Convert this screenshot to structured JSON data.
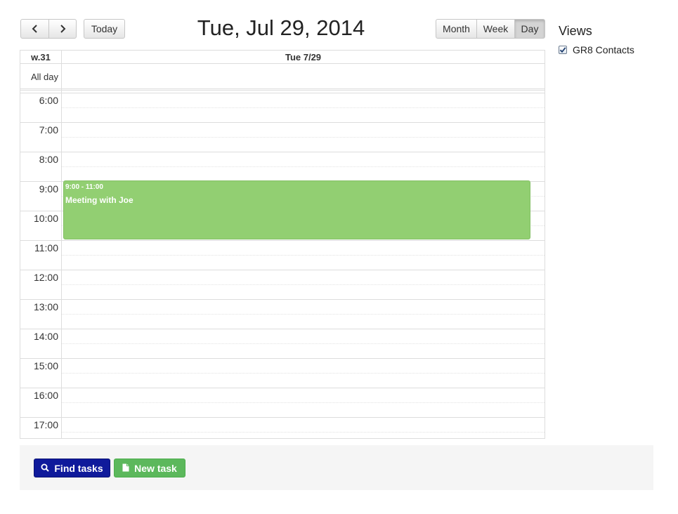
{
  "toolbar": {
    "prev_icon": "chevron-left-icon",
    "next_icon": "chevron-right-icon",
    "today_label": "Today",
    "title": "Tue, Jul 29, 2014",
    "views": {
      "month_label": "Month",
      "week_label": "Week",
      "day_label": "Day",
      "active": "Day"
    }
  },
  "calendar": {
    "week_label": "w.31",
    "day_header": "Tue 7/29",
    "allday_label": "All day",
    "hours": [
      "6:00",
      "7:00",
      "8:00",
      "9:00",
      "10:00",
      "11:00",
      "12:00",
      "13:00",
      "14:00",
      "15:00",
      "16:00",
      "17:00"
    ],
    "events": [
      {
        "time": "9:00 - 11:00",
        "title": "Meeting with Joe",
        "color": "#92cf72"
      }
    ]
  },
  "sidebar": {
    "title": "Views",
    "items": [
      {
        "label": "GR8 Contacts",
        "checked": true
      }
    ]
  },
  "footer": {
    "find_tasks_label": "Find tasks",
    "find_tasks_icon": "search-icon",
    "find_tasks_color": "#0f1a9b",
    "new_task_label": "New task",
    "new_task_icon": "document-icon",
    "new_task_color": "#5cb85c"
  }
}
